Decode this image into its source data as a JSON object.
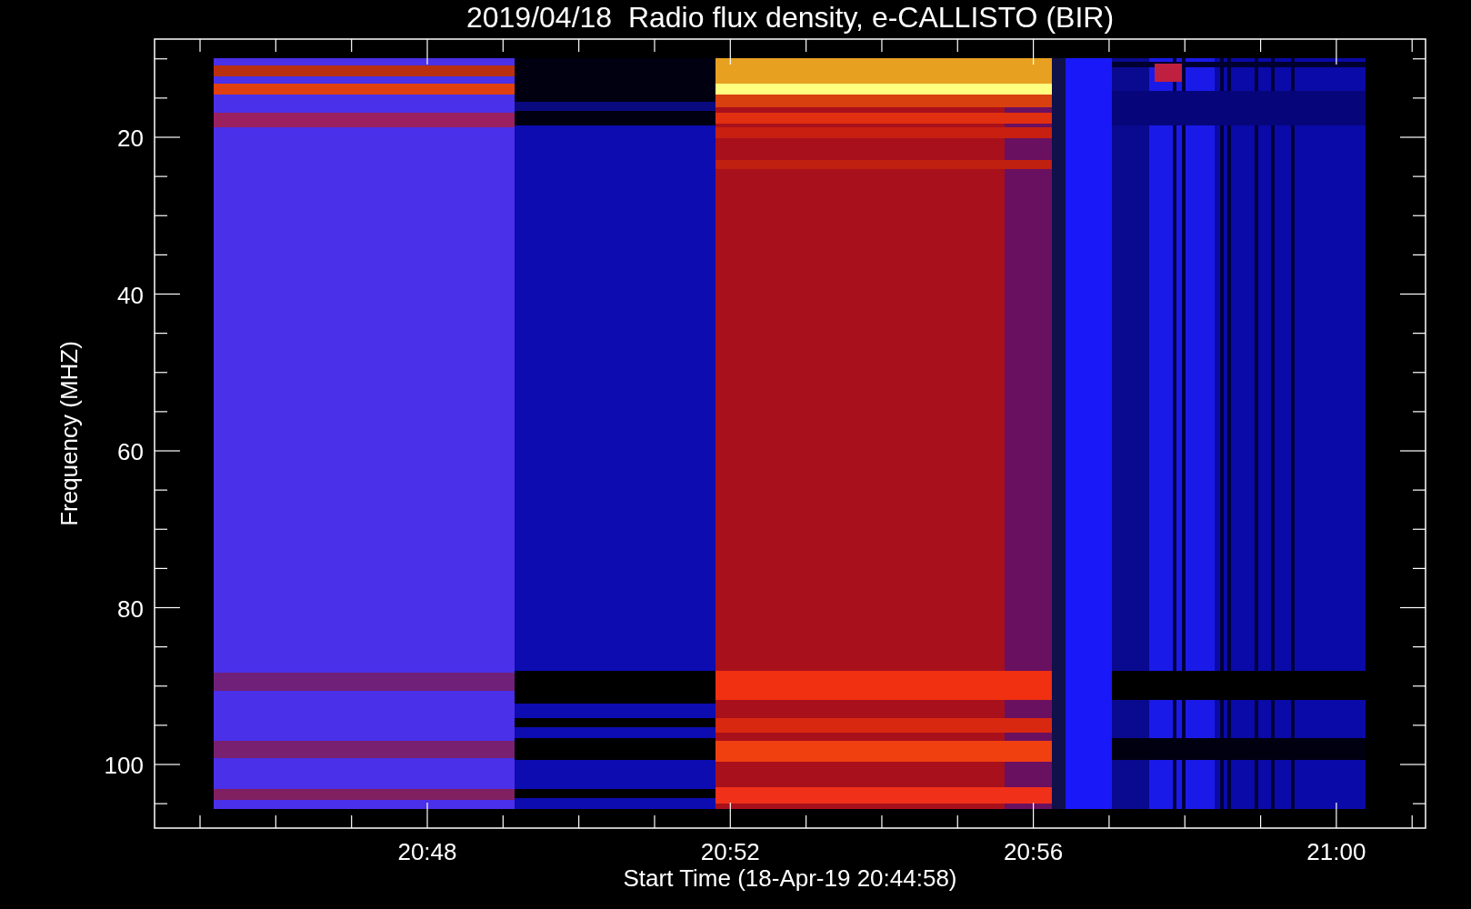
{
  "title": "2019/04/18  Radio flux density, e-CALLISTO (BIR)",
  "y_axis": {
    "label": "Frequency (MHZ)",
    "tick_labels": [
      "20",
      "40",
      "60",
      "80",
      "100"
    ]
  },
  "x_axis": {
    "label": "Start Time (18-Apr-19 20:44:58)",
    "tick_labels": [
      "20:48",
      "20:52",
      "20:56",
      "21:00"
    ]
  }
}
